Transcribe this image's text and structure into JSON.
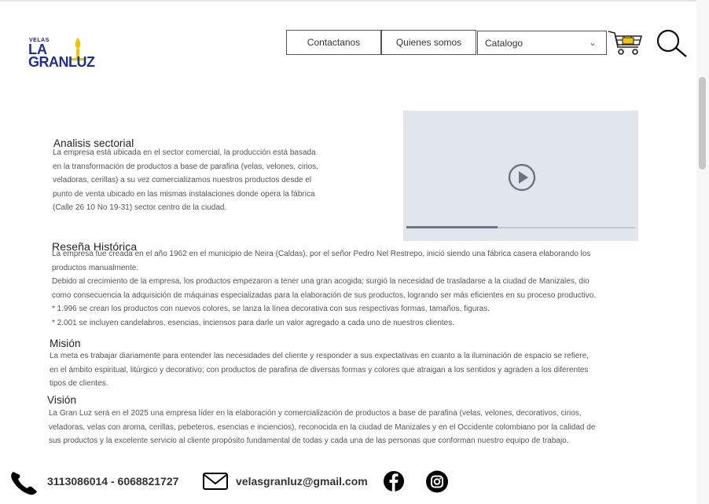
{
  "logo": {
    "small": "VELAS",
    "line1": "LA",
    "line2": "GRANLUZ"
  },
  "nav": {
    "contact_label": "Contactanos",
    "about_label": "Quienes somos",
    "catalog_selected": "Catalogo"
  },
  "video": {
    "progress": 0.4
  },
  "sections": {
    "analisis": {
      "title": "Analisis sectorial",
      "lines": [
        "La empresa está ubicada en el sector comercial, la producción está basada",
        "en la transformación de productos a base de parafina (velas, velones, cirios,",
        "veladoras, cerillas) a su vez comercializamos  nuestros productos desde el",
        "punto de venta ubicado en las mismas instalaciones donde opera la fábrica",
        "(Calle 26 10 No 19-31) sector centro de la ciudad."
      ]
    },
    "resena": {
      "title": "Reseña Histórica",
      "lines": [
        "La empresa fue creada en el año 1962 en el municipio de Neira (Caldas), por el señor Pedro Nel Restrepo, inició siendo una fábrica casera elaborando los",
        "productos manualmente.",
        "Debido al crecimiento de la empresa, los productos empezaron a tener una gran acogida; surgió la necesidad de trasladarse a la ciudad de Manizales, dio",
        "como consecuencia la adquisición de máquinas especializadas para la elaboración de sus productos, logrando ser más eficientes en su proceso productivo.",
        "* 1.996 se crean los productos con nuevos colores, se lanza la línea decorativa con sus respectivas formas, tamaños, figuras.",
        "* 2.001 se  incluyen candelabros, esencias, inciensos para darle un valor agregado a cada uno de nuestros clientes."
      ]
    },
    "mision": {
      "title": "Misión",
      "lines": [
        "La meta es trabajar diariamente para entender las necesidades del cliente y responder a sus expectativas en cuanto a la iluminación de espacio se refiere,",
        "en el ámbito espiritual, litúrgico y decorativo; con productos de parafina de diversas formas y colores que atraigan a los sentidos y agraden a los diferentes",
        "tipos de clientes."
      ]
    },
    "vision": {
      "title": "Visión",
      "lines": [
        "La Gran Luz será en el 2025 una empresa líder en la elaboración y comercialización de productos a base de parafina (velas, velones, decorativos, cirios,",
        "veladoras, velas con aroma, cerillas, pebeteros, esencias e inciencios), reconocida en la ciudad de Manizales y en el Occidente colombiano por la calidad de",
        "sus productos y la excelente servicio al cliente propósito fundamental de todas y cada una de las personas que conforman nuestro equipo de trabajo."
      ]
    }
  },
  "footer": {
    "phones": "3113086014 - 6068821727",
    "email": "velasgranluz@gmail.com"
  },
  "icons": [
    "phone-icon",
    "mail-icon",
    "facebook-icon",
    "instagram-icon",
    "cart-icon",
    "search-icon",
    "play-icon",
    "chevron-down-icon",
    "candle-icon"
  ]
}
